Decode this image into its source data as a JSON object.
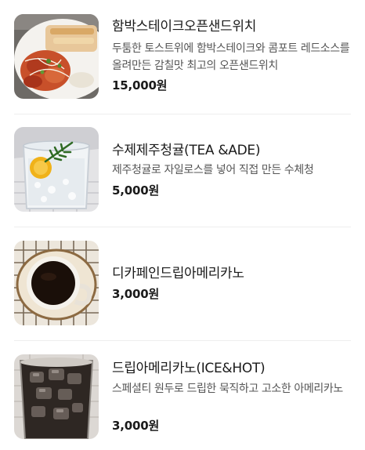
{
  "menu": {
    "items": [
      {
        "name": "함박스테이크오픈샌드위치",
        "description": "두툼한 토스트위에 함박스테이크와 콤포트 레드소스를 올려만든 감칠맛 최고의 오픈샌드위치",
        "price": "15,000원",
        "image_icon": "open-sandwich-photo"
      },
      {
        "name": "수제제주청귤(TEA &ADE)",
        "description": "제주청귤로 자일로스를 넣어 직접 만든 수체청",
        "price": "5,000원",
        "image_icon": "citrus-ade-photo"
      },
      {
        "name": "디카페인드립아메리카노",
        "description": "",
        "price": "3,000원",
        "image_icon": "hot-americano-cup-photo"
      },
      {
        "name": "드립아메리카노(ICE&HOT)",
        "description": "스페셜티 원두로 드립한 묵직하고 고소한 아메리카노",
        "price": "3,000원",
        "image_icon": "iced-americano-glass-photo"
      }
    ]
  }
}
